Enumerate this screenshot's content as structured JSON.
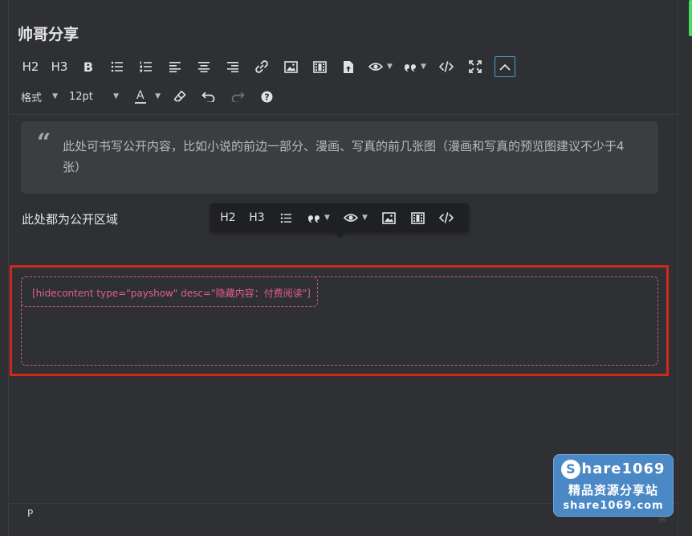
{
  "editor": {
    "title": "帅哥分享",
    "toolbar_row1": {
      "h2_label": "H2",
      "h3_label": "H3",
      "bold_label": "B"
    },
    "toolbar_row2": {
      "format_label": "格式",
      "font_size": "12pt",
      "text_color_label": "A"
    },
    "blockquote_text": "此处可书写公开内容，比如小说的前边一部分、漫画、写真的前几张图（漫画和写真的预览图建议不少于4张）",
    "public_paragraph": "此处都为公开区域",
    "floating_toolbar": {
      "h2_label": "H2",
      "h3_label": "H3"
    },
    "hidden_shortcode": "[hidecontent type=\"payshow\" desc=\"隐藏内容：付费阅读\"]",
    "status_path": "P"
  },
  "watermark": {
    "logo_letter": "S",
    "line1": "hare1069",
    "line2": "精品资源分享站",
    "line3": "share1069.com"
  },
  "colors": {
    "background": "#2f3033",
    "accent_blue": "#4a9fd8",
    "highlight_red": "#d3271b",
    "shortcode_pink": "#e0608a"
  }
}
